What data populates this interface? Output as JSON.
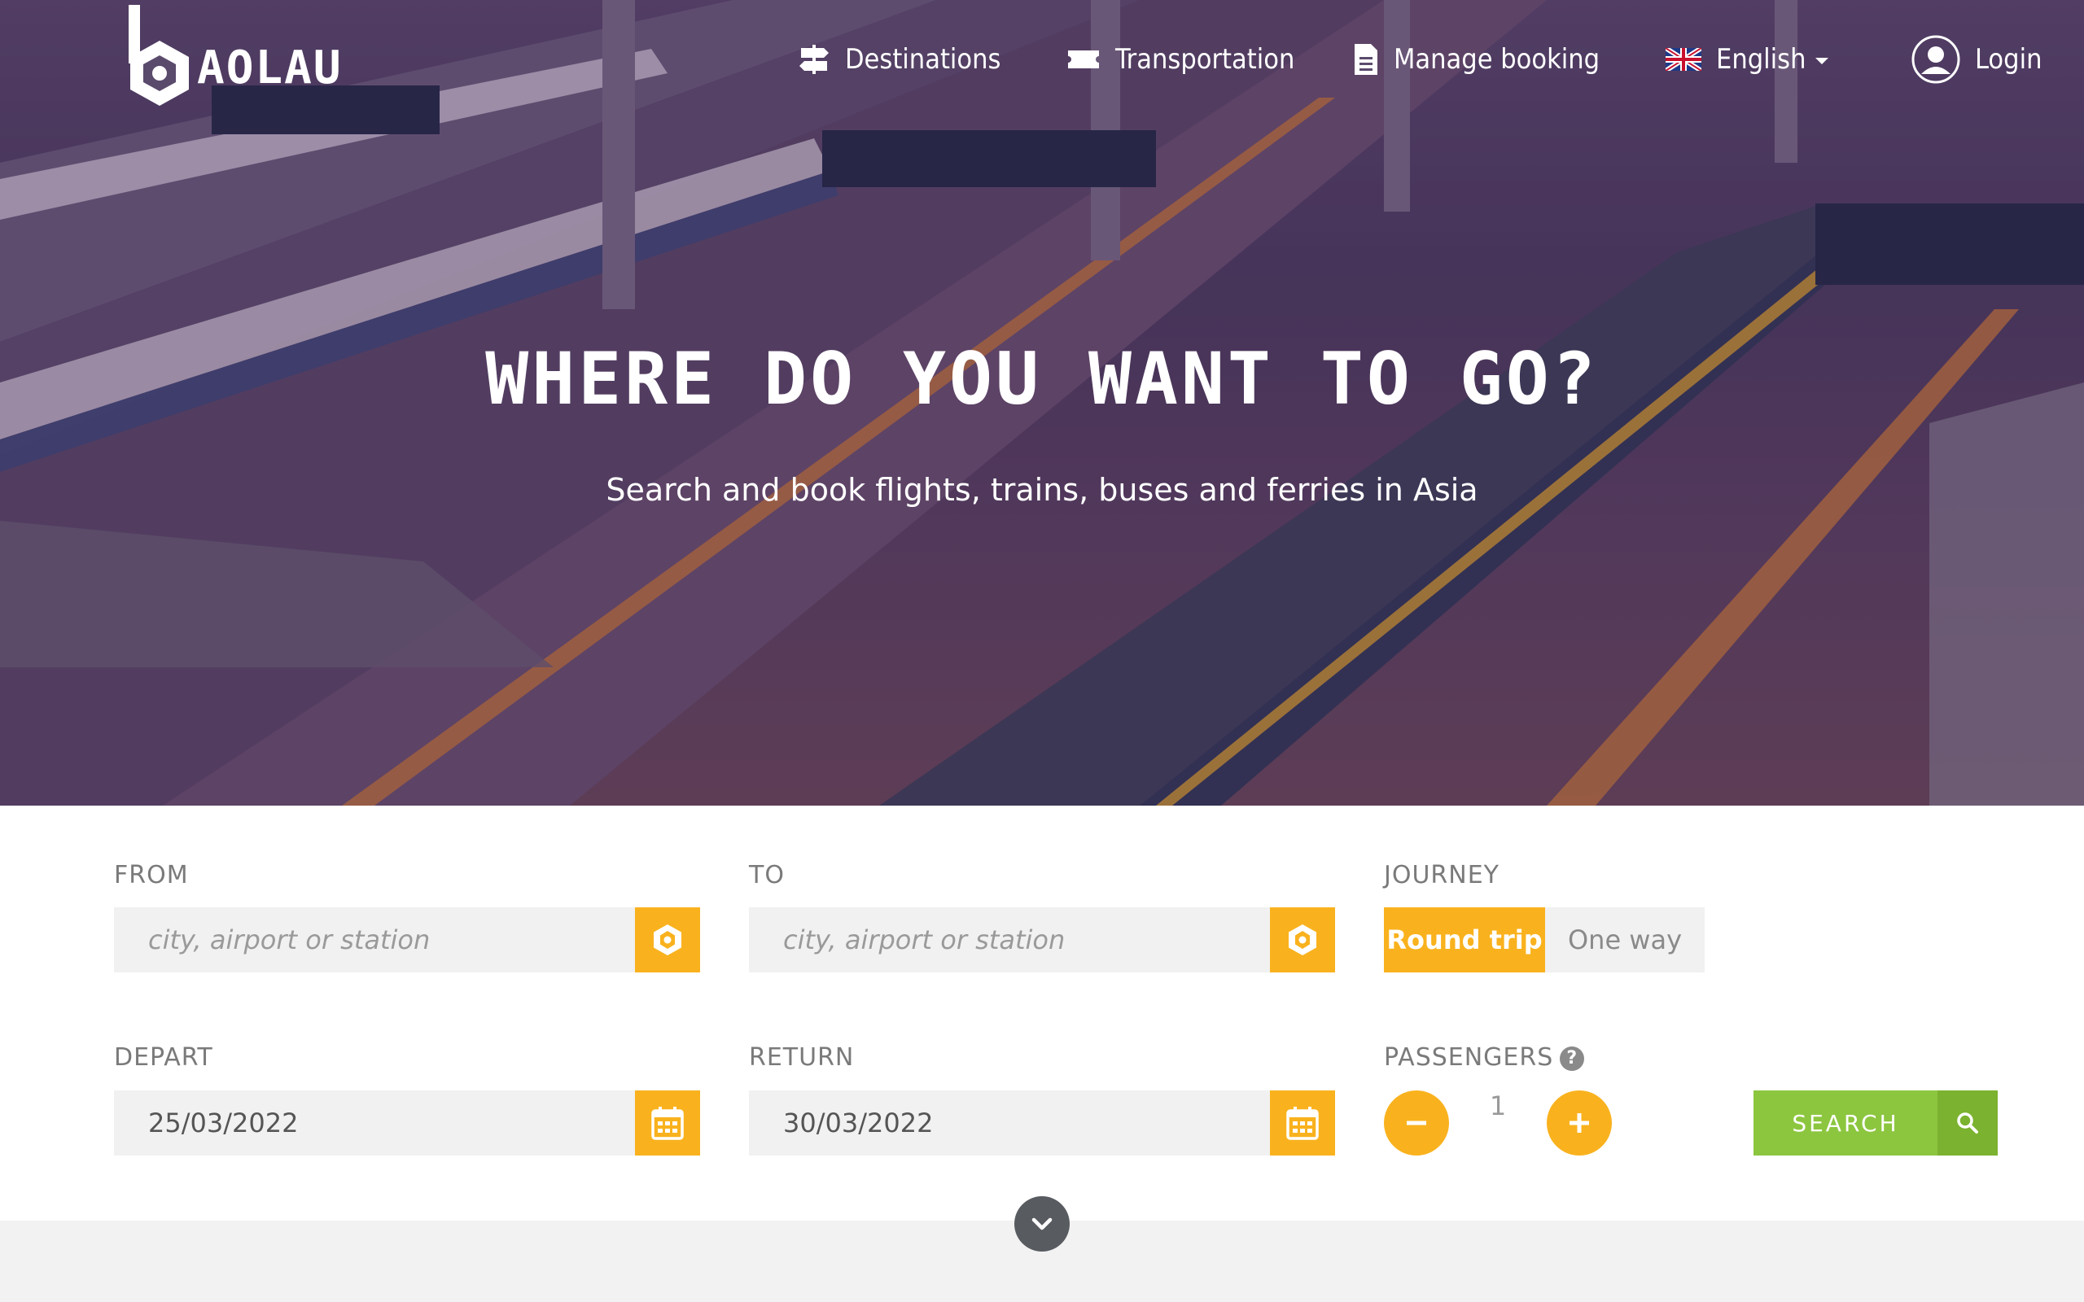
{
  "brand": {
    "logo_text": "AOLAU",
    "accent": "#f9b21e",
    "search_green": "#8cc63f"
  },
  "nav": {
    "destinations": "Destinations",
    "transportation": "Transportation",
    "manage_booking": "Manage booking",
    "language": "English",
    "login": "Login"
  },
  "hero": {
    "title": "WHERE DO YOU WANT TO GO?",
    "subtitle": "Search and book flights, trains, buses and ferries in Asia"
  },
  "form": {
    "from": {
      "label": "FROM",
      "placeholder": "city, airport or station"
    },
    "to": {
      "label": "TO",
      "placeholder": "city, airport or station"
    },
    "journey": {
      "label": "JOURNEY",
      "options": [
        "Round trip",
        "One way"
      ],
      "selected": "Round trip"
    },
    "depart": {
      "label": "DEPART",
      "value": "25/03/2022"
    },
    "return": {
      "label": "RETURN",
      "value": "30/03/2022"
    },
    "passengers": {
      "label": "PASSENGERS",
      "help": "?",
      "value": "1"
    },
    "search_label": "SEARCH"
  }
}
